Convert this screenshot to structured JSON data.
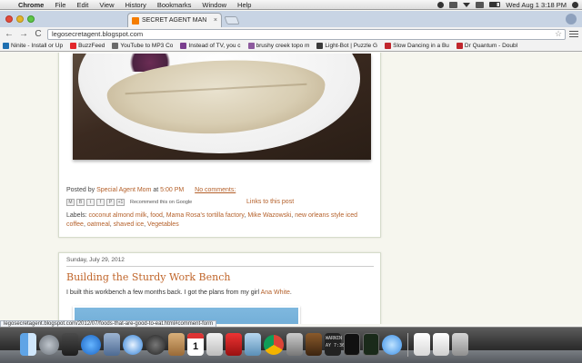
{
  "menubar": {
    "apple_glyph": "",
    "app_name": "Chrome",
    "items": [
      "File",
      "Edit",
      "View",
      "History",
      "Bookmarks",
      "Window",
      "Help"
    ],
    "clock": "Wed Aug 1  3:18 PM"
  },
  "browser": {
    "tab_title": "SECRET AGENT MAN",
    "tab_close": "×",
    "url": "legosecretagent.blogspot.com",
    "back_glyph": "←",
    "forward_glyph": "→",
    "reload_glyph": "C",
    "star_glyph": "☆"
  },
  "bookmarks": [
    {
      "label": "Ninite - Install or Up",
      "color": "#1f6fb0"
    },
    {
      "label": "BuzzFeed",
      "color": "#e3262a"
    },
    {
      "label": "YouTube to MP3 Co",
      "color": "#6a6a6a"
    },
    {
      "label": "Instead of TV, you c",
      "color": "#7a3e8e"
    },
    {
      "label": "brushy creek topo m",
      "color": "#8d5a9e"
    },
    {
      "label": "Light-Bot | Puzzle G",
      "color": "#3a3a3a"
    },
    {
      "label": "Slow Dancing in a Bu",
      "color": "#c0262d"
    },
    {
      "label": "Dr Quantum - Doubl",
      "color": "#c0262d"
    }
  ],
  "post1": {
    "posted_by_prefix": "Posted by",
    "author": "Special Agent Mom",
    "at": "at",
    "time": "5:00 PM",
    "comments": "No comments:",
    "share_buttons": [
      "M",
      "B",
      "t",
      "f",
      "P",
      "+1"
    ],
    "recommend": "Recommend this on Google",
    "links_to_post": "Links to this post",
    "labels_prefix": "Labels:",
    "labels": [
      "coconut almond milk",
      "food",
      "Mama Rosa's tortilla factory",
      "Mike Wazowski",
      "new orleans style iced coffee",
      "oatmeal",
      "shaved ice",
      "Vegetables"
    ]
  },
  "post2": {
    "date": "Sunday, July 29, 2012",
    "title": "Building the Sturdy Work Bench",
    "text_before": "I built this workbench a few months back.  I got the plans from my girl ",
    "text_link": "Ana White",
    "text_after": "."
  },
  "status_url": "legosecretagent.blogspot.com/2012/07/foods-that-are-good-to-eat.html#comment-form",
  "dock": {
    "calendar_day": "1",
    "console_text": "WARNIN\nAY 7:36"
  }
}
